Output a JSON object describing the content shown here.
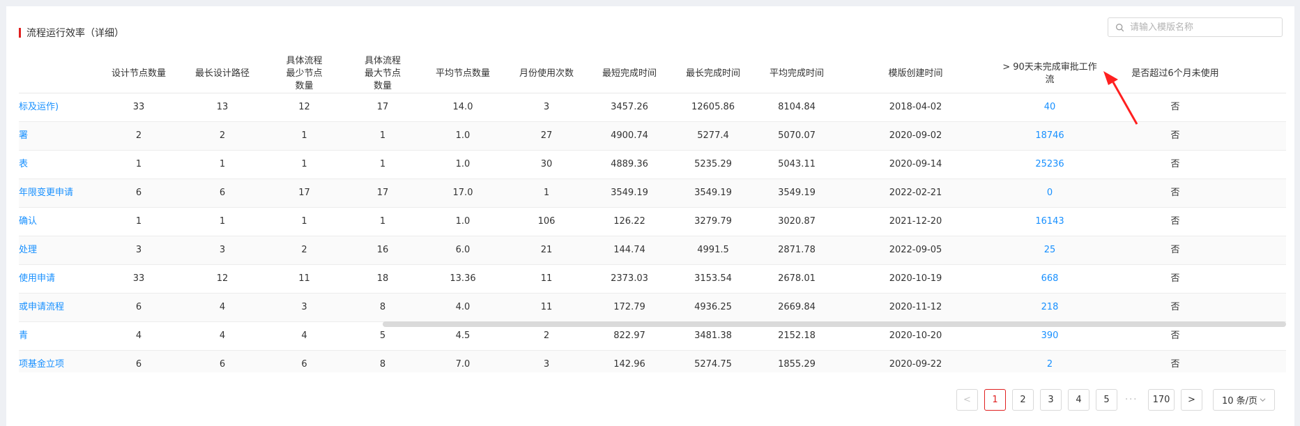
{
  "header": {
    "title": "流程运行效率（详细）",
    "search_placeholder": "请输入模版名称"
  },
  "table": {
    "columns": [
      "",
      "设计节点数量",
      "最长设计路径",
      "具体流程最少节点数量",
      "具体流程最大节点数量",
      "平均节点数量",
      "月份使用次数",
      "最短完成时间",
      "最长完成时间",
      "平均完成时间",
      "模版创建时间",
      "> 90天未完成审批工作流",
      "是否超过6个月未使用"
    ],
    "rows": [
      {
        "name": "标及运作)",
        "design_nodes": "33",
        "longest_path": "13",
        "min_nodes": "12",
        "max_nodes": "17",
        "avg_nodes": "14.0",
        "monthly_uses": "3",
        "min_time": "3457.26",
        "max_time": "12605.86",
        "avg_time": "8104.84",
        "created": "2018-04-02",
        "pending_90": "40",
        "unused_6m": "否"
      },
      {
        "name": "署",
        "design_nodes": "2",
        "longest_path": "2",
        "min_nodes": "1",
        "max_nodes": "1",
        "avg_nodes": "1.0",
        "monthly_uses": "27",
        "min_time": "4900.74",
        "max_time": "5277.4",
        "avg_time": "5070.07",
        "created": "2020-09-02",
        "pending_90": "18746",
        "unused_6m": "否"
      },
      {
        "name": "表",
        "design_nodes": "1",
        "longest_path": "1",
        "min_nodes": "1",
        "max_nodes": "1",
        "avg_nodes": "1.0",
        "monthly_uses": "30",
        "min_time": "4889.36",
        "max_time": "5235.29",
        "avg_time": "5043.11",
        "created": "2020-09-14",
        "pending_90": "25236",
        "unused_6m": "否"
      },
      {
        "name": "年限变更申请",
        "design_nodes": "6",
        "longest_path": "6",
        "min_nodes": "17",
        "max_nodes": "17",
        "avg_nodes": "17.0",
        "monthly_uses": "1",
        "min_time": "3549.19",
        "max_time": "3549.19",
        "avg_time": "3549.19",
        "created": "2022-02-21",
        "pending_90": "0",
        "unused_6m": "否"
      },
      {
        "name": "确认",
        "design_nodes": "1",
        "longest_path": "1",
        "min_nodes": "1",
        "max_nodes": "1",
        "avg_nodes": "1.0",
        "monthly_uses": "106",
        "min_time": "126.22",
        "max_time": "3279.79",
        "avg_time": "3020.87",
        "created": "2021-12-20",
        "pending_90": "16143",
        "unused_6m": "否"
      },
      {
        "name": "处理",
        "design_nodes": "3",
        "longest_path": "3",
        "min_nodes": "2",
        "max_nodes": "16",
        "avg_nodes": "6.0",
        "monthly_uses": "21",
        "min_time": "144.74",
        "max_time": "4991.5",
        "avg_time": "2871.78",
        "created": "2022-09-05",
        "pending_90": "25",
        "unused_6m": "否"
      },
      {
        "name": "使用申请",
        "design_nodes": "33",
        "longest_path": "12",
        "min_nodes": "11",
        "max_nodes": "18",
        "avg_nodes": "13.36",
        "monthly_uses": "11",
        "min_time": "2373.03",
        "max_time": "3153.54",
        "avg_time": "2678.01",
        "created": "2020-10-19",
        "pending_90": "668",
        "unused_6m": "否"
      },
      {
        "name": "或申请流程",
        "design_nodes": "6",
        "longest_path": "4",
        "min_nodes": "3",
        "max_nodes": "8",
        "avg_nodes": "4.0",
        "monthly_uses": "11",
        "min_time": "172.79",
        "max_time": "4936.25",
        "avg_time": "2669.84",
        "created": "2020-11-12",
        "pending_90": "218",
        "unused_6m": "否"
      },
      {
        "name": "青",
        "design_nodes": "4",
        "longest_path": "4",
        "min_nodes": "4",
        "max_nodes": "5",
        "avg_nodes": "4.5",
        "monthly_uses": "2",
        "min_time": "822.97",
        "max_time": "3481.38",
        "avg_time": "2152.18",
        "created": "2020-10-20",
        "pending_90": "390",
        "unused_6m": "否"
      },
      {
        "name": "项基金立项",
        "design_nodes": "6",
        "longest_path": "6",
        "min_nodes": "6",
        "max_nodes": "8",
        "avg_nodes": "7.0",
        "monthly_uses": "3",
        "min_time": "142.96",
        "max_time": "5274.75",
        "avg_time": "1855.29",
        "created": "2020-09-22",
        "pending_90": "2",
        "unused_6m": "否"
      }
    ]
  },
  "pagination": {
    "prev": "<",
    "pages": [
      "1",
      "2",
      "3",
      "4",
      "5"
    ],
    "active_page": "1",
    "ellipsis": "···",
    "last_page": "170",
    "next": ">",
    "page_size": "10 条/页"
  },
  "colors": {
    "accent": "#e02020",
    "link": "#1890ff",
    "annotation_arrow": "#ff2020"
  }
}
